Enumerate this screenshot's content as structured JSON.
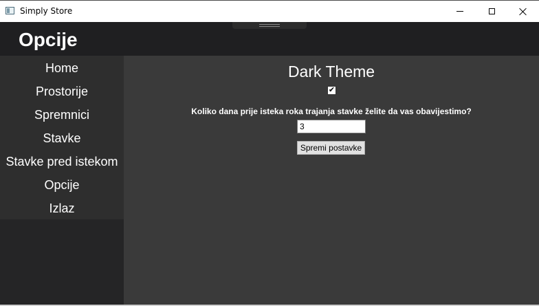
{
  "window": {
    "title": "Simply Store",
    "controls": [
      "minimize",
      "maximize",
      "close"
    ]
  },
  "header": {
    "title": "Opcije"
  },
  "sidebar": {
    "items": [
      {
        "label": "Home"
      },
      {
        "label": "Prostorije"
      },
      {
        "label": "Spremnici"
      },
      {
        "label": "Stavke"
      },
      {
        "label": "Stavke pred istekom"
      },
      {
        "label": "Opcije"
      },
      {
        "label": "Izlaz"
      }
    ]
  },
  "settings": {
    "theme_title": "Dark Theme",
    "dark_theme_checked": true,
    "days_question": "Koliko dana prije isteka roka trajanja stavke želite da vas obavijestimo?",
    "days_value": "3",
    "save_label": "Spremi postavke"
  },
  "colors": {
    "header_bg": "#1f1f21",
    "sidebar_bg": "#2e2e2e",
    "content_bg": "#3a3a3a",
    "text": "#ffffff"
  }
}
